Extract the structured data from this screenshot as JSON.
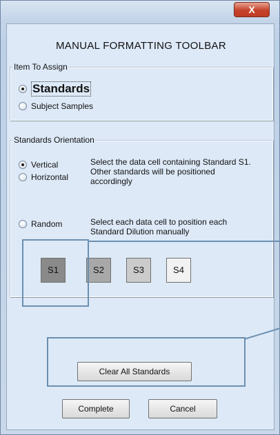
{
  "window": {
    "close_glyph": "X"
  },
  "heading": "MANUAL FORMATTING TOOLBAR",
  "item_to_assign": {
    "legend": "Item To Assign",
    "options": [
      {
        "label": "Standards",
        "selected": true
      },
      {
        "label": "Subject Samples",
        "selected": false
      }
    ]
  },
  "standards_orientation": {
    "legend": "Standards Orientation",
    "options": [
      {
        "label": "Vertical",
        "selected": true
      },
      {
        "label": "Horizontal",
        "selected": false
      },
      {
        "label": "Random",
        "selected": false
      }
    ],
    "vh_description": "Select the data cell containing Standard S1.  Other standards will be positioned accordingly",
    "random_description": "Select each data cell to position each Standard Dilution manually",
    "standards": [
      {
        "label": "S1",
        "color": "#8a8a8a"
      },
      {
        "label": "S2",
        "color": "#a8a8a8"
      },
      {
        "label": "S3",
        "color": "#cbcbcb"
      },
      {
        "label": "S4",
        "color": "#f2f2f2"
      }
    ]
  },
  "buttons": {
    "clear_all": "Clear All Standards",
    "complete": "Complete",
    "cancel": "Cancel"
  },
  "colors": {
    "annotation": "#6b8fb0"
  }
}
